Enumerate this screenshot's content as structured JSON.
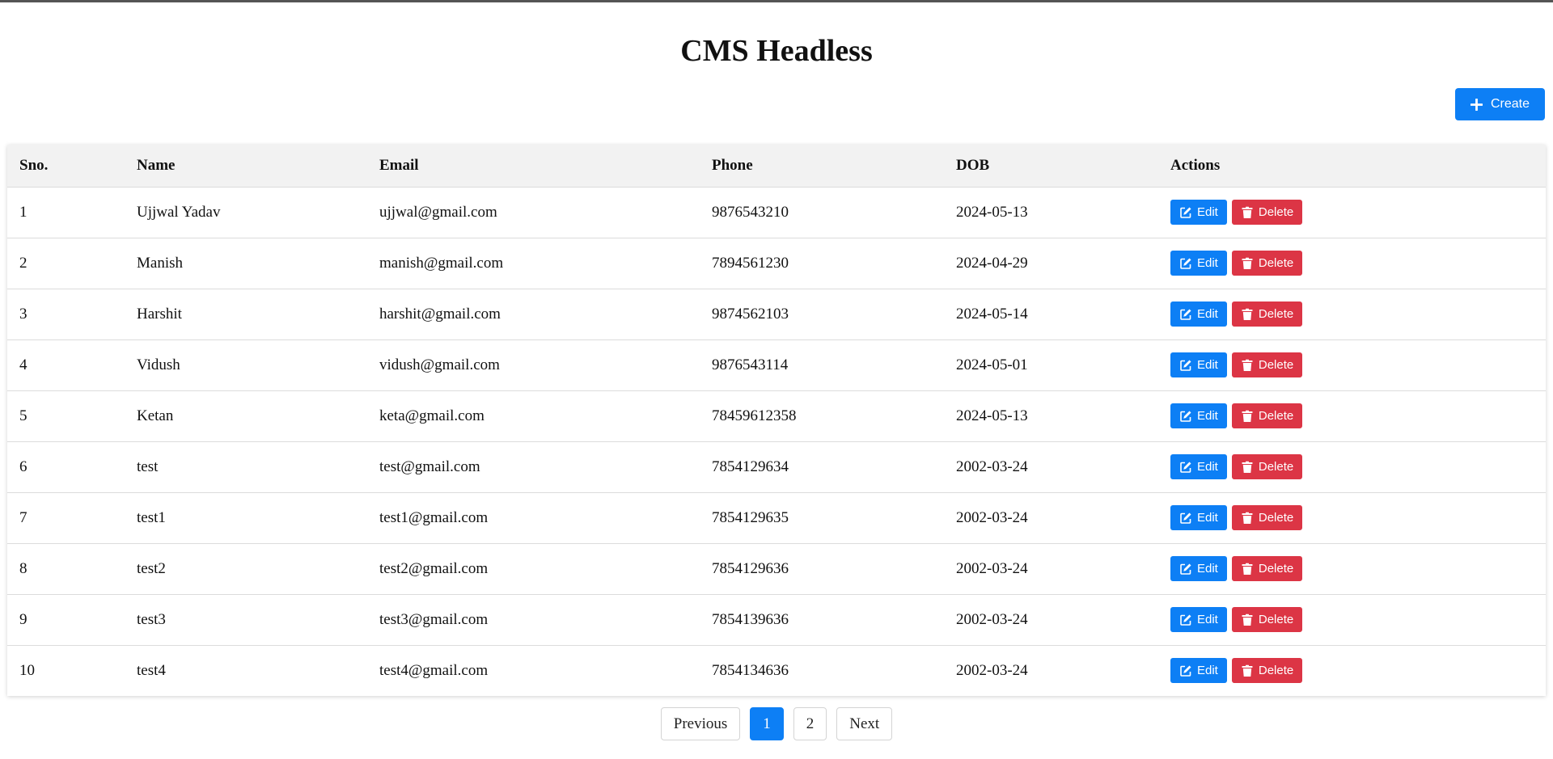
{
  "page": {
    "title": "CMS Headless"
  },
  "toolbar": {
    "create_label": "Create",
    "create_icon": "plus-icon"
  },
  "table": {
    "headers": {
      "sno": "Sno.",
      "name": "Name",
      "email": "Email",
      "phone": "Phone",
      "dob": "DOB",
      "actions": "Actions"
    },
    "edit_label": "Edit",
    "delete_label": "Delete",
    "edit_icon": "edit-icon",
    "delete_icon": "trash-icon",
    "rows": [
      {
        "sno": "1",
        "name": "Ujjwal Yadav",
        "email": "ujjwal@gmail.com",
        "phone": "9876543210",
        "dob": "2024-05-13"
      },
      {
        "sno": "2",
        "name": "Manish",
        "email": "manish@gmail.com",
        "phone": "7894561230",
        "dob": "2024-04-29"
      },
      {
        "sno": "3",
        "name": "Harshit",
        "email": "harshit@gmail.com",
        "phone": "9874562103",
        "dob": "2024-05-14"
      },
      {
        "sno": "4",
        "name": "Vidush",
        "email": "vidush@gmail.com",
        "phone": "9876543114",
        "dob": "2024-05-01"
      },
      {
        "sno": "5",
        "name": "Ketan",
        "email": "keta@gmail.com",
        "phone": "78459612358",
        "dob": "2024-05-13"
      },
      {
        "sno": "6",
        "name": "test",
        "email": "test@gmail.com",
        "phone": "7854129634",
        "dob": "2002-03-24"
      },
      {
        "sno": "7",
        "name": "test1",
        "email": "test1@gmail.com",
        "phone": "7854129635",
        "dob": "2002-03-24"
      },
      {
        "sno": "8",
        "name": "test2",
        "email": "test2@gmail.com",
        "phone": "7854129636",
        "dob": "2002-03-24"
      },
      {
        "sno": "9",
        "name": "test3",
        "email": "test3@gmail.com",
        "phone": "7854139636",
        "dob": "2002-03-24"
      },
      {
        "sno": "10",
        "name": "test4",
        "email": "test4@gmail.com",
        "phone": "7854134636",
        "dob": "2002-03-24"
      }
    ]
  },
  "pagination": {
    "previous_label": "Previous",
    "next_label": "Next",
    "pages": [
      "1",
      "2"
    ],
    "current_page": "1"
  },
  "colors": {
    "primary": "#0d7ff5",
    "danger": "#dc3545",
    "header_bg": "#f2f2f2"
  }
}
